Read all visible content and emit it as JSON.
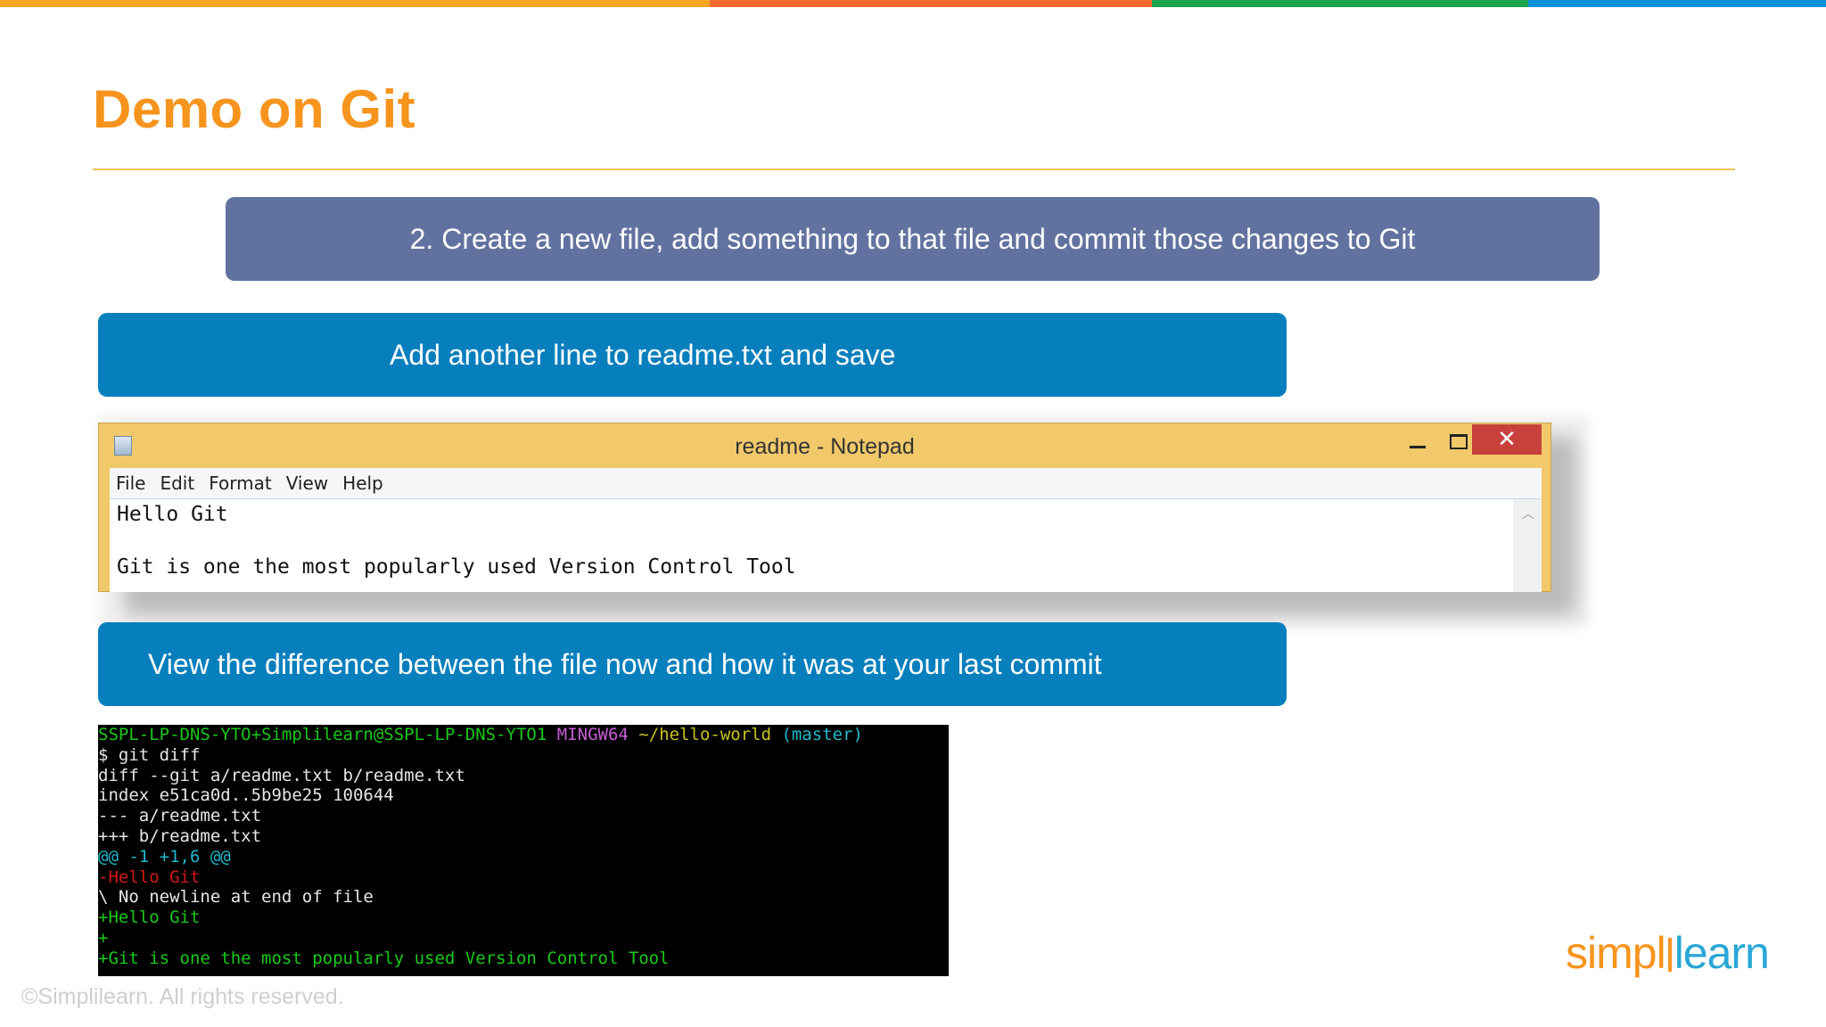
{
  "brand_colors": [
    "#f7941d",
    "#f26a2f",
    "#1aa34a",
    "#0a8fd6"
  ],
  "slide": {
    "title": "Demo on Git",
    "step_banner": "2. Create a new file, add something to that file and commit those changes to Git",
    "instruction_1": "Add another line to readme.txt and save",
    "instruction_2": "View the difference between the file now and how it was at your last commit"
  },
  "notepad": {
    "title": "readme - Notepad",
    "icons": {
      "app": "notepad-icon",
      "minimize": "minimize-icon",
      "maximize": "maximize-icon",
      "close": "close-icon"
    },
    "close_glyph": "✕",
    "menu": [
      "File",
      "Edit",
      "Format",
      "View",
      "Help"
    ],
    "lines": [
      "Hello Git",
      "",
      "Git is one the most popularly used Version Control Tool"
    ]
  },
  "terminal": {
    "prompt_user": "SSPL-LP-DNS-YTO+Simplilearn@SSPL-LP-DNS-YTO1",
    "prompt_env": "MINGW64",
    "prompt_path": "~/hello-world",
    "prompt_branch": "(master)",
    "command": "$ git diff",
    "lines": [
      "diff --git a/readme.txt b/readme.txt",
      "index e51ca0d..5b9be25 100644",
      "--- a/readme.txt",
      "+++ b/readme.txt"
    ],
    "hunk_header": "@@ -1 +1,6 @@",
    "removed_line": "-Hello Git",
    "no_newline": "\\ No newline at end of file",
    "added_lines": [
      "+Hello Git",
      "+",
      "+Git is one the most popularly used Version Control Tool"
    ]
  },
  "footer": {
    "copyright": "©Simplilearn. All rights reserved.",
    "logo_part1": "simpl",
    "logo_part2": "learn"
  }
}
